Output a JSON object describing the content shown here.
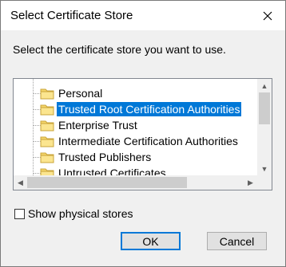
{
  "window": {
    "title": "Select Certificate Store"
  },
  "prompt": "Select the certificate store you want to use.",
  "stores": [
    {
      "label": "Personal",
      "selected": false
    },
    {
      "label": "Trusted Root Certification Authorities",
      "selected": true
    },
    {
      "label": "Enterprise Trust",
      "selected": false
    },
    {
      "label": "Intermediate Certification Authorities",
      "selected": false
    },
    {
      "label": "Trusted Publishers",
      "selected": false
    },
    {
      "label": "Untrusted Certificates",
      "selected": false
    }
  ],
  "checkbox": {
    "label": "Show physical stores",
    "checked": false
  },
  "buttons": {
    "ok": "OK",
    "cancel": "Cancel"
  },
  "colors": {
    "selection": "#0078d7",
    "folder": "#f5d66a"
  }
}
